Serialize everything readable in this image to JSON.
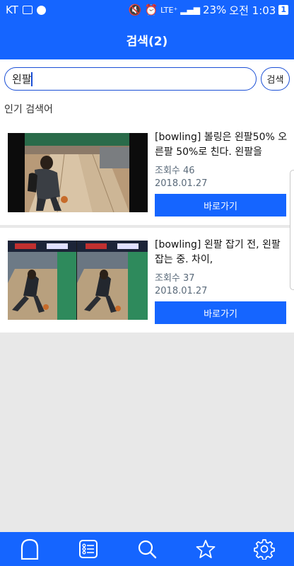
{
  "status_bar": {
    "carrier": "KT",
    "network": "LTE⁺",
    "battery": "23%",
    "time": "오전 1:03",
    "notification_count": "1"
  },
  "header": {
    "title": "검색(2)"
  },
  "search": {
    "query": "왼팔",
    "button_label": "검색",
    "popular_label": "인기 검색어"
  },
  "results": [
    {
      "title": "[bowling] 볼링은 왼팔50% 오른팔 50%로 친다. 왼팔을",
      "views": "조회수 46",
      "date": "2018.01.27",
      "button_label": "바로가기"
    },
    {
      "title": "[bowling] 왼팔 잡기 전, 왼팔 잡는 중. 차이,",
      "views": "조회수 37",
      "date": "2018.01.27",
      "button_label": "바로가기"
    }
  ],
  "bottom_nav": [
    {
      "icon": "home-arch-icon"
    },
    {
      "icon": "list-icon"
    },
    {
      "icon": "search-icon"
    },
    {
      "icon": "star-icon"
    },
    {
      "icon": "gear-icon"
    }
  ],
  "colors": {
    "primary": "#1565ff",
    "border": "#1a4fd6",
    "background": "#e8e8e8"
  }
}
